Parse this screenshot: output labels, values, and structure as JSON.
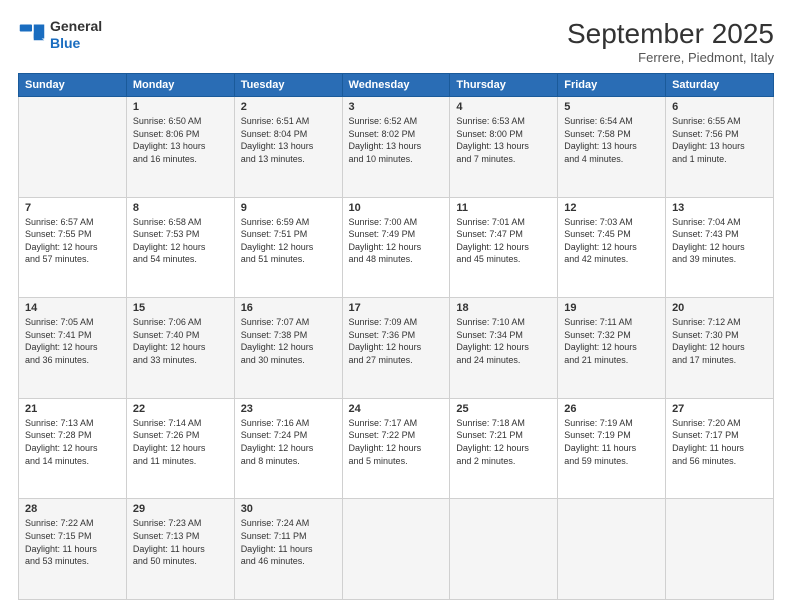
{
  "header": {
    "logo_general": "General",
    "logo_blue": "Blue",
    "month_title": "September 2025",
    "location": "Ferrere, Piedmont, Italy"
  },
  "weekdays": [
    "Sunday",
    "Monday",
    "Tuesday",
    "Wednesday",
    "Thursday",
    "Friday",
    "Saturday"
  ],
  "weeks": [
    [
      {
        "day": "",
        "content": ""
      },
      {
        "day": "1",
        "content": "Sunrise: 6:50 AM\nSunset: 8:06 PM\nDaylight: 13 hours\nand 16 minutes."
      },
      {
        "day": "2",
        "content": "Sunrise: 6:51 AM\nSunset: 8:04 PM\nDaylight: 13 hours\nand 13 minutes."
      },
      {
        "day": "3",
        "content": "Sunrise: 6:52 AM\nSunset: 8:02 PM\nDaylight: 13 hours\nand 10 minutes."
      },
      {
        "day": "4",
        "content": "Sunrise: 6:53 AM\nSunset: 8:00 PM\nDaylight: 13 hours\nand 7 minutes."
      },
      {
        "day": "5",
        "content": "Sunrise: 6:54 AM\nSunset: 7:58 PM\nDaylight: 13 hours\nand 4 minutes."
      },
      {
        "day": "6",
        "content": "Sunrise: 6:55 AM\nSunset: 7:56 PM\nDaylight: 13 hours\nand 1 minute."
      }
    ],
    [
      {
        "day": "7",
        "content": "Sunrise: 6:57 AM\nSunset: 7:55 PM\nDaylight: 12 hours\nand 57 minutes."
      },
      {
        "day": "8",
        "content": "Sunrise: 6:58 AM\nSunset: 7:53 PM\nDaylight: 12 hours\nand 54 minutes."
      },
      {
        "day": "9",
        "content": "Sunrise: 6:59 AM\nSunset: 7:51 PM\nDaylight: 12 hours\nand 51 minutes."
      },
      {
        "day": "10",
        "content": "Sunrise: 7:00 AM\nSunset: 7:49 PM\nDaylight: 12 hours\nand 48 minutes."
      },
      {
        "day": "11",
        "content": "Sunrise: 7:01 AM\nSunset: 7:47 PM\nDaylight: 12 hours\nand 45 minutes."
      },
      {
        "day": "12",
        "content": "Sunrise: 7:03 AM\nSunset: 7:45 PM\nDaylight: 12 hours\nand 42 minutes."
      },
      {
        "day": "13",
        "content": "Sunrise: 7:04 AM\nSunset: 7:43 PM\nDaylight: 12 hours\nand 39 minutes."
      }
    ],
    [
      {
        "day": "14",
        "content": "Sunrise: 7:05 AM\nSunset: 7:41 PM\nDaylight: 12 hours\nand 36 minutes."
      },
      {
        "day": "15",
        "content": "Sunrise: 7:06 AM\nSunset: 7:40 PM\nDaylight: 12 hours\nand 33 minutes."
      },
      {
        "day": "16",
        "content": "Sunrise: 7:07 AM\nSunset: 7:38 PM\nDaylight: 12 hours\nand 30 minutes."
      },
      {
        "day": "17",
        "content": "Sunrise: 7:09 AM\nSunset: 7:36 PM\nDaylight: 12 hours\nand 27 minutes."
      },
      {
        "day": "18",
        "content": "Sunrise: 7:10 AM\nSunset: 7:34 PM\nDaylight: 12 hours\nand 24 minutes."
      },
      {
        "day": "19",
        "content": "Sunrise: 7:11 AM\nSunset: 7:32 PM\nDaylight: 12 hours\nand 21 minutes."
      },
      {
        "day": "20",
        "content": "Sunrise: 7:12 AM\nSunset: 7:30 PM\nDaylight: 12 hours\nand 17 minutes."
      }
    ],
    [
      {
        "day": "21",
        "content": "Sunrise: 7:13 AM\nSunset: 7:28 PM\nDaylight: 12 hours\nand 14 minutes."
      },
      {
        "day": "22",
        "content": "Sunrise: 7:14 AM\nSunset: 7:26 PM\nDaylight: 12 hours\nand 11 minutes."
      },
      {
        "day": "23",
        "content": "Sunrise: 7:16 AM\nSunset: 7:24 PM\nDaylight: 12 hours\nand 8 minutes."
      },
      {
        "day": "24",
        "content": "Sunrise: 7:17 AM\nSunset: 7:22 PM\nDaylight: 12 hours\nand 5 minutes."
      },
      {
        "day": "25",
        "content": "Sunrise: 7:18 AM\nSunset: 7:21 PM\nDaylight: 12 hours\nand 2 minutes."
      },
      {
        "day": "26",
        "content": "Sunrise: 7:19 AM\nSunset: 7:19 PM\nDaylight: 11 hours\nand 59 minutes."
      },
      {
        "day": "27",
        "content": "Sunrise: 7:20 AM\nSunset: 7:17 PM\nDaylight: 11 hours\nand 56 minutes."
      }
    ],
    [
      {
        "day": "28",
        "content": "Sunrise: 7:22 AM\nSunset: 7:15 PM\nDaylight: 11 hours\nand 53 minutes."
      },
      {
        "day": "29",
        "content": "Sunrise: 7:23 AM\nSunset: 7:13 PM\nDaylight: 11 hours\nand 50 minutes."
      },
      {
        "day": "30",
        "content": "Sunrise: 7:24 AM\nSunset: 7:11 PM\nDaylight: 11 hours\nand 46 minutes."
      },
      {
        "day": "",
        "content": ""
      },
      {
        "day": "",
        "content": ""
      },
      {
        "day": "",
        "content": ""
      },
      {
        "day": "",
        "content": ""
      }
    ]
  ]
}
